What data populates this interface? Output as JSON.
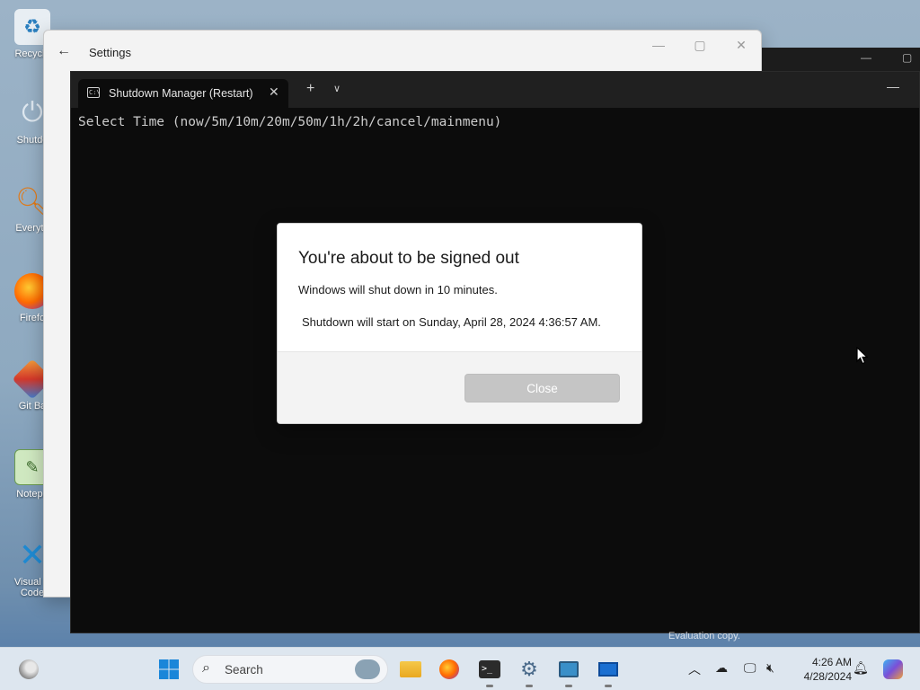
{
  "desktop": {
    "icons": [
      {
        "label": "Recycle",
        "icon": "recycle-bin-icon"
      },
      {
        "label": "Shutdo",
        "icon": "power-icon"
      },
      {
        "label": "Everyth",
        "icon": "magnifier-icon"
      },
      {
        "label": "Firefo",
        "icon": "firefox-icon"
      },
      {
        "label": "Git Ba",
        "icon": "git-icon"
      },
      {
        "label": "Notepa",
        "icon": "notepad-icon"
      },
      {
        "label": "Visual S",
        "label2": "Code",
        "icon": "vscode-icon"
      }
    ]
  },
  "settings_window": {
    "title": "Settings"
  },
  "terminal": {
    "tab_title": "Shutdown Manager (Restart)",
    "prompt": "Select Time (now/5m/10m/20m/50m/1h/2h/cancel/mainmenu)"
  },
  "dialog": {
    "title": "You're about to be signed out",
    "message": "Windows will shut down in 10 minutes.",
    "detail": "Shutdown will start on Sunday, April 28, 2024 4:36:57 AM.",
    "close_label": "Close"
  },
  "watermark": "Evaluation copy.",
  "taskbar": {
    "search_placeholder": "Search",
    "time": "4:26 AM",
    "date": "4/28/2024",
    "pinned": [
      "edge-icon",
      "start-icon",
      "file-explorer-icon",
      "firefox-icon",
      "terminal-icon",
      "settings-icon",
      "remote-desktop-icon",
      "app-icon"
    ]
  }
}
